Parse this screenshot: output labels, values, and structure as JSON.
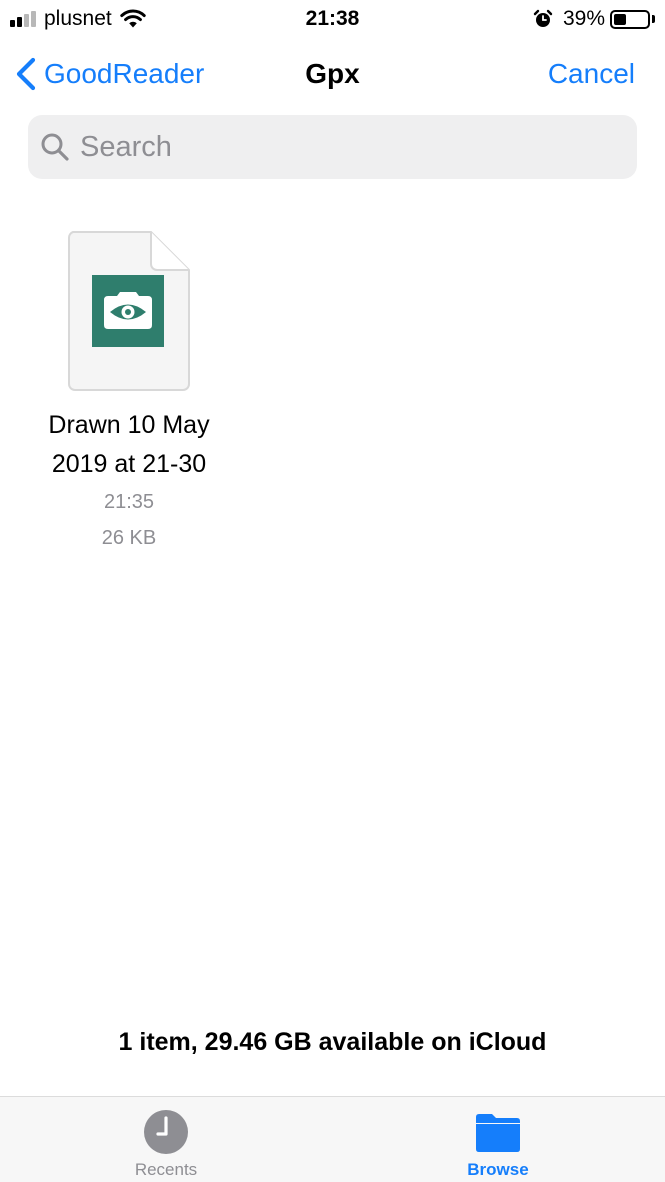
{
  "status_bar": {
    "carrier": "plusnet",
    "time": "21:38",
    "battery_percent_label": "39%",
    "battery_level": 0.39,
    "signal_bars_filled": 2,
    "signal_bars_total": 4,
    "icons": [
      "signal-icon",
      "wifi-icon",
      "alarm-icon",
      "battery-icon"
    ]
  },
  "nav": {
    "back_label": "GoodReader",
    "title": "Gpx",
    "cancel_label": "Cancel",
    "back_icon": "chevron-left-icon"
  },
  "search": {
    "placeholder": "Search",
    "value": "",
    "icon": "search-icon"
  },
  "files": [
    {
      "name": "Drawn 10 May 2019 at 21-30",
      "time": "21:35",
      "size": "26 KB",
      "icon": "goodreader-eye-icon"
    }
  ],
  "summary": "1 item, 29.46 GB available on iCloud",
  "tabs": [
    {
      "label": "Recents",
      "icon": "clock-icon",
      "active": false
    },
    {
      "label": "Browse",
      "icon": "folder-icon",
      "active": true
    }
  ],
  "colors": {
    "accent": "#157efb",
    "secondary_text": "#8e8e93",
    "search_bg": "#efeff0",
    "app_badge": "#2f7e6d",
    "tab_bar_bg": "#f7f7f7"
  }
}
